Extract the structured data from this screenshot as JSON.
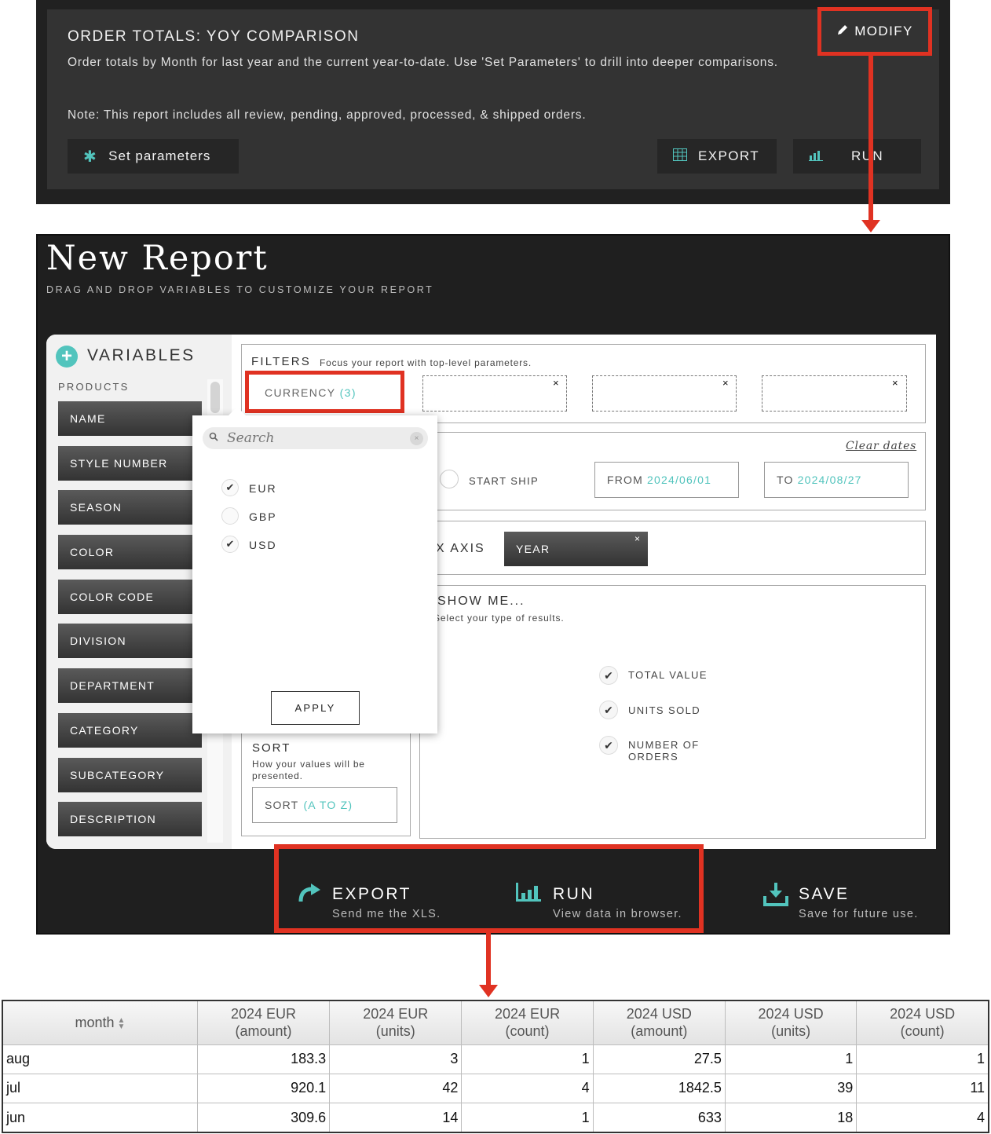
{
  "top_panel": {
    "title": "ORDER TOTALS: YOY COMPARISON",
    "description": "Order totals by Month for last year and the current year-to-date. Use 'Set Parameters' to drill into deeper comparisons.",
    "note": "Note: This report includes all review, pending, approved, processed, & shipped orders.",
    "buttons": {
      "set_parameters": "Set parameters",
      "export": "EXPORT",
      "run": "RUN",
      "modify": "MODIFY"
    }
  },
  "new_report": {
    "title": "New Report",
    "subtitle": "DRAG AND DROP VARIABLES TO CUSTOMIZE YOUR REPORT",
    "variables": {
      "title": "VARIABLES",
      "group": "PRODUCTS",
      "items": [
        "NAME",
        "STYLE NUMBER",
        "SEASON",
        "COLOR",
        "COLOR CODE",
        "DIVISION",
        "DEPARTMENT",
        "CATEGORY",
        "SUBCATEGORY",
        "DESCRIPTION"
      ]
    },
    "filters": {
      "label": "FILTERS",
      "description": "Focus your report with top-level parameters.",
      "currency_label": "CURRENCY",
      "currency_count": "(3)",
      "remove_symbol": "×"
    },
    "dates": {
      "clear": "Clear dates",
      "start_ship": "START SHIP",
      "from_label": "FROM",
      "from_value": "2024/06/01",
      "to_label": "TO",
      "to_value": "2024/08/27"
    },
    "x_axis": {
      "label": "X AXIS",
      "chip": "YEAR"
    },
    "sort": {
      "label": "SORT",
      "description": "How your values will be presented.",
      "field_label": "SORT",
      "field_value": "(A TO Z)"
    },
    "show_me": {
      "label": "SHOW ME...",
      "description": "Select your type of results.",
      "options": [
        {
          "label": "TOTAL VALUE",
          "checked": true
        },
        {
          "label": "UNITS SOLD",
          "checked": true
        },
        {
          "label": "NUMBER OF ORDERS",
          "checked": true
        }
      ]
    },
    "currency_dropdown": {
      "search_placeholder": "Search",
      "clear_symbol": "×",
      "options": [
        {
          "label": "EUR",
          "checked": true
        },
        {
          "label": "GBP",
          "checked": false
        },
        {
          "label": "USD",
          "checked": true
        }
      ],
      "apply": "APPLY"
    },
    "actions": {
      "export_title": "EXPORT",
      "export_sub": "Send me the XLS.",
      "run_title": "RUN",
      "run_sub": "View data in browser.",
      "save_title": "SAVE",
      "save_sub": "Save for future use."
    }
  },
  "results": {
    "columns": [
      {
        "line1": "month",
        "line2": ""
      },
      {
        "line1": "2024 EUR",
        "line2": "(amount)"
      },
      {
        "line1": "2024 EUR",
        "line2": "(units)"
      },
      {
        "line1": "2024 EUR",
        "line2": "(count)"
      },
      {
        "line1": "2024 USD",
        "line2": "(amount)"
      },
      {
        "line1": "2024 USD",
        "line2": "(units)"
      },
      {
        "line1": "2024 USD",
        "line2": "(count)"
      }
    ],
    "rows": [
      [
        "aug",
        "183.3",
        "3",
        "1",
        "27.5",
        "1",
        "1"
      ],
      [
        "jul",
        "920.1",
        "42",
        "4",
        "1842.5",
        "39",
        "11"
      ],
      [
        "jun",
        "309.6",
        "14",
        "1",
        "633",
        "18",
        "4"
      ]
    ]
  },
  "colors": {
    "accent": "#52c4bd",
    "highlight": "#e03222",
    "dark_bg": "#1f1f1f",
    "panel_bg": "#333333"
  }
}
